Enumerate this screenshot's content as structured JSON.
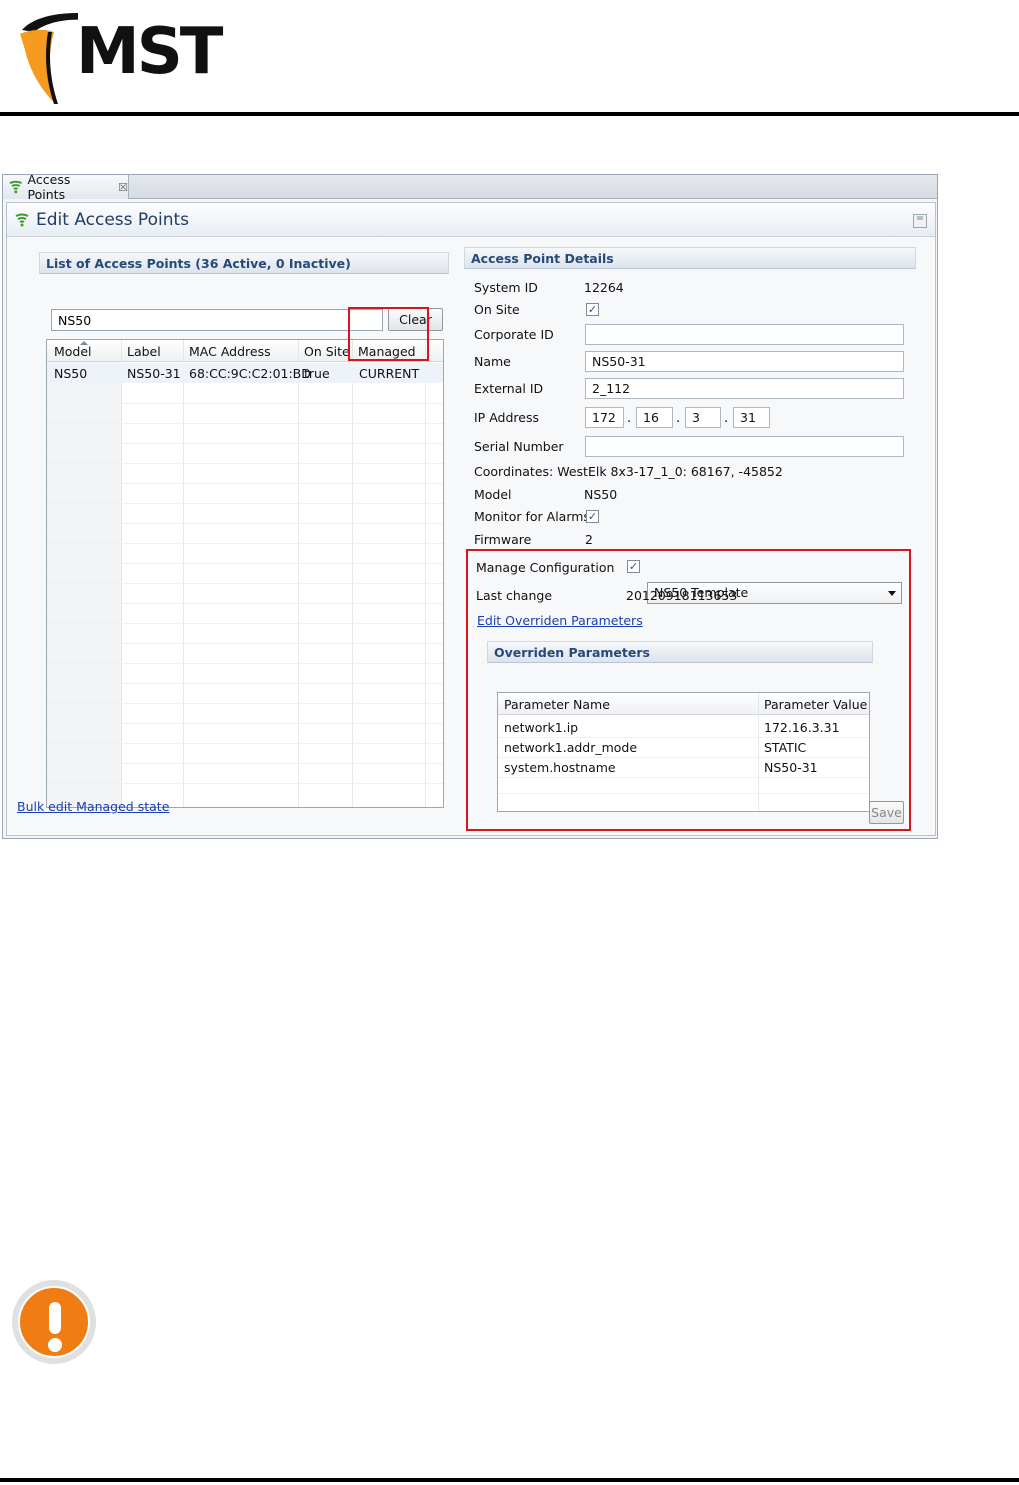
{
  "brand": {
    "logo_text": "MST",
    "accent": "#f39a1f"
  },
  "tab": {
    "label": "Access Points",
    "close": "☒"
  },
  "editor": {
    "title": "Edit Access Points"
  },
  "list": {
    "header": "List of Access Points (36 Active, 0 Inactive)",
    "search_value": "NS50",
    "clear_label": "Clear",
    "columns": [
      "Model",
      "Label",
      "MAC Address",
      "On Site",
      "Managed"
    ],
    "rows": [
      {
        "model": "NS50",
        "label": "NS50-31",
        "mac": "68:CC:9C:C2:01:BD",
        "on_site": "true",
        "managed": "CURRENT"
      }
    ],
    "bulk_link": "Bulk edit Managed state"
  },
  "details": {
    "header": "Access Point Details",
    "system_id_label": "System ID",
    "system_id": "12264",
    "on_site_label": "On Site",
    "corporate_id_label": "Corporate ID",
    "corporate_id": "",
    "name_label": "Name",
    "name": "NS50-31",
    "external_id_label": "External ID",
    "external_id": "2_112",
    "ip_label": "IP Address",
    "ip": [
      "172",
      "16",
      "3",
      "31"
    ],
    "serial_label": "Serial Number",
    "serial": "",
    "coordinates": "Coordinates: WestElk 8x3-17_1_0: 68167, -45852",
    "model_label": "Model",
    "model": "NS50",
    "monitor_label": "Monitor for Alarms",
    "firmware_label": "Firmware",
    "firmware": "2",
    "check_mark": "✓"
  },
  "config": {
    "manage_label": "Manage Configuration",
    "template": "NS50 Template",
    "last_change_label": "Last change",
    "last_change": "20120918113653",
    "edit_link": "Edit Overriden Parameters",
    "overrides_header": "Overriden Parameters",
    "columns": [
      "Parameter Name",
      "Parameter Value"
    ],
    "rows": [
      {
        "name": "network1.ip",
        "value": "172.16.3.31"
      },
      {
        "name": "network1.addr_mode",
        "value": "STATIC"
      },
      {
        "name": "system.hostname",
        "value": "NS50-31"
      }
    ],
    "save_label": "Save"
  }
}
